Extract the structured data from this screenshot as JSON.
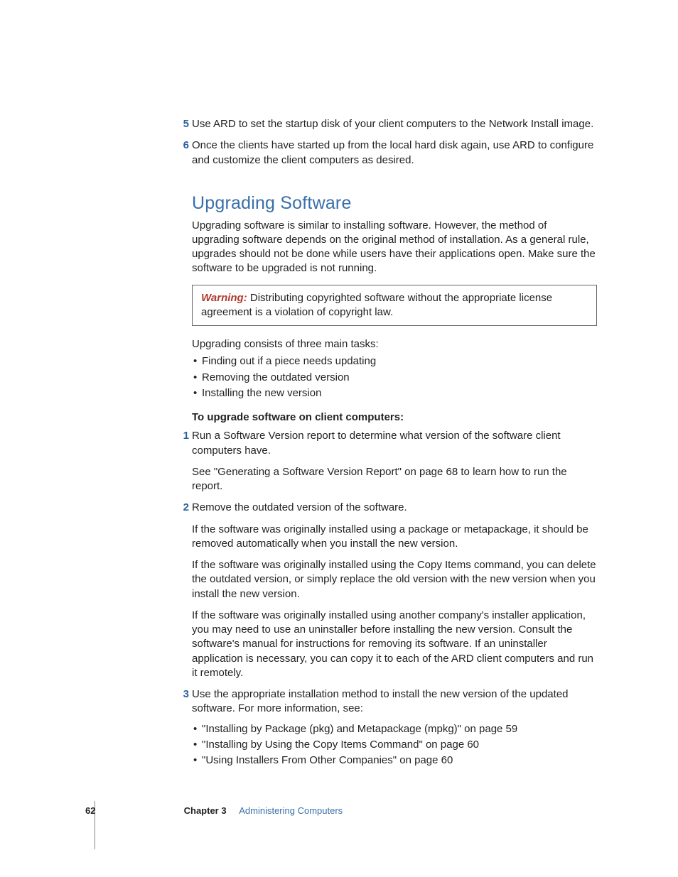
{
  "prior_steps": [
    {
      "num": "5",
      "text": "Use ARD to set the startup disk of your client computers to the Network Install image."
    },
    {
      "num": "6",
      "text": "Once the clients have started up from the local hard disk again, use ARD to configure and customize the client computers as desired."
    }
  ],
  "heading": "Upgrading Software",
  "intro": "Upgrading software is similar to installing software. However, the method of upgrading software depends on the original method of installation. As a general rule, upgrades should not be done while users have their applications open. Make sure the software to be upgraded is not running.",
  "warning": {
    "label": "Warning:",
    "text": "  Distributing copyrighted software without the appropriate license agreement is a violation of copyright law."
  },
  "tasks_lead": "Upgrading consists of three main tasks:",
  "tasks": [
    "Finding out if a piece needs updating",
    "Removing the outdated version",
    "Installing the new version"
  ],
  "proc_heading": "To upgrade software on client computers:",
  "steps": [
    {
      "num": "1",
      "text": "Run a Software Version report to determine what version of the software client computers have.",
      "subs": [
        "See \"Generating a Software Version Report\" on page 68 to learn how to run the report."
      ]
    },
    {
      "num": "2",
      "text": "Remove the outdated version of the software.",
      "subs": [
        "If the software was originally installed using a package or metapackage, it should be removed automatically when you install the new version.",
        "If the software was originally installed using the Copy Items command, you can delete the outdated version, or simply replace the old version with the new version when you install the new version.",
        "If the software was originally installed using another company's installer application, you may need to use an uninstaller before installing the new version. Consult the software's manual for instructions for removing its software. If an uninstaller application is necessary, you can copy it to each of the ARD client computers and run it remotely."
      ]
    },
    {
      "num": "3",
      "text": "Use the appropriate installation method to install the new version of the updated software. For more information, see:",
      "bullets": [
        "\"Installing by Package (pkg) and Metapackage (mpkg)\" on page 59",
        "\"Installing by Using the Copy Items Command\" on page 60",
        "\"Using Installers From Other Companies\" on page 60"
      ]
    }
  ],
  "footer": {
    "page": "62",
    "chapter": "Chapter 3",
    "title": "Administering Computers"
  }
}
